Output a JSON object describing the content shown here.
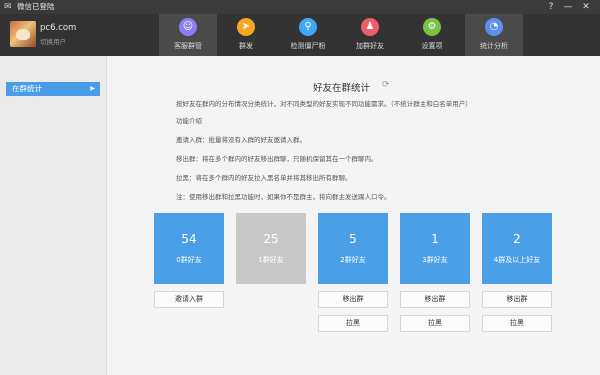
{
  "window": {
    "title": "微信已登陆",
    "help_icon": "?",
    "minimize_icon": "—",
    "close_icon": "✕"
  },
  "user": {
    "name": "pc6.com",
    "switch_label": "切换用户"
  },
  "nav": [
    {
      "label": "客服群管",
      "icon": "user-group-icon",
      "color": "#8a7ff0"
    },
    {
      "label": "群发",
      "icon": "send-icon",
      "color": "#f5a623"
    },
    {
      "label": "检测僵尸粉",
      "icon": "search-user-icon",
      "color": "#3fa8f5"
    },
    {
      "label": "加群好友",
      "icon": "add-friend-icon",
      "color": "#ef5d6b"
    },
    {
      "label": "设置项",
      "icon": "gear-icon",
      "color": "#7cc242"
    },
    {
      "label": "统计分析",
      "icon": "pie-chart-icon",
      "color": "#5b8ff0"
    }
  ],
  "sidebar": {
    "items": [
      {
        "label": "在群统计"
      }
    ]
  },
  "main": {
    "title": "好友在群统计",
    "description": "按好友在群内的分布情况分类统计，对不同类型的好友实现不同功能需求。（不统计群主和白名单用户）",
    "features_heading": "功能介绍",
    "invite_desc": "邀请入群：批量将没有入群的好友邀请入群。",
    "remove_desc": "移出群：将在多个群内的好友移出群聊，只随机保留其在一个群聊内。",
    "block_desc": "拉黑：将在多个群内的好友拉入黑名单并将其移出所有群聊。",
    "note": "注：使用移出群和拉黑功能时，如果你不是群主，将向群主发送踢人口令。"
  },
  "cards": [
    {
      "count": "54",
      "label": "0群好友",
      "color": "#4a9fe6",
      "primary": "邀请入群",
      "secondary": ""
    },
    {
      "count": "25",
      "label": "1群好友",
      "color": "#c8c8c8",
      "primary": "",
      "secondary": ""
    },
    {
      "count": "5",
      "label": "2群好友",
      "color": "#4a9fe6",
      "primary": "移出群",
      "secondary": "拉黑"
    },
    {
      "count": "1",
      "label": "3群好友",
      "color": "#4a9fe6",
      "primary": "移出群",
      "secondary": "拉黑"
    },
    {
      "count": "2",
      "label": "4群及以上好友",
      "color": "#4a9fe6",
      "primary": "移出群",
      "secondary": "拉黑"
    }
  ]
}
